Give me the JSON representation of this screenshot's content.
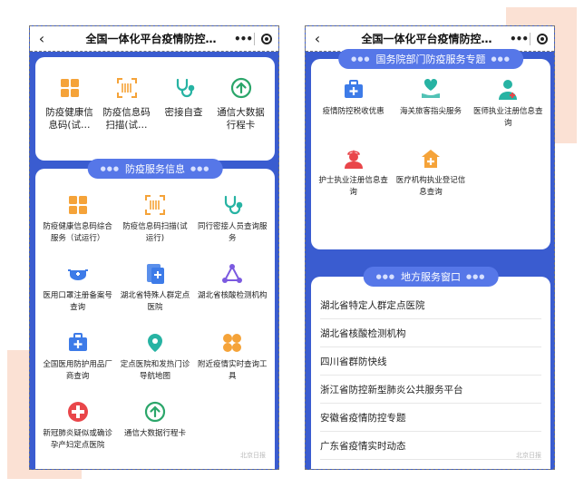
{
  "left_phone": {
    "title": "全国一体化平台疫情防控…",
    "quick_items": [
      {
        "icon": "grid-icon",
        "label": "防疫健康信息码(试…"
      },
      {
        "icon": "barcode-scan-icon",
        "label": "防疫信息码扫描(试…"
      },
      {
        "icon": "stethoscope-icon",
        "label": "密接自查"
      },
      {
        "icon": "arrow-up-circle-icon",
        "label": "通信大数据行程卡"
      }
    ],
    "section": {
      "title": "防疫服务信息",
      "items": [
        {
          "icon": "grid-icon",
          "label": "防疫健康信息码综合服务（试运行）"
        },
        {
          "icon": "barcode-scan-icon",
          "label": "防疫信息码扫描(试运行)"
        },
        {
          "icon": "stethoscope-icon",
          "label": "同行密接人员查询服务"
        },
        {
          "icon": "mask-icon",
          "label": "医用口罩注册备案号查询"
        },
        {
          "icon": "document-plus-icon",
          "label": "湖北省特殊人群定点医院"
        },
        {
          "icon": "network-icon",
          "label": "湖北省核酸检测机构"
        },
        {
          "icon": "medical-kit-icon",
          "label": "全国医用防护用品厂商查询"
        },
        {
          "icon": "location-pin-icon",
          "label": "定点医院和发热门诊导航地图"
        },
        {
          "icon": "clover-icon",
          "label": "附近疫情实时查询工具"
        },
        {
          "icon": "red-cross-icon",
          "label": "新冠肺炎疑似或确诊孕产妇定点医院"
        },
        {
          "icon": "arrow-up-circle-icon",
          "label": "通信大数据行程卡"
        }
      ],
      "watermark": "北京日报"
    }
  },
  "right_phone": {
    "title": "全国一体化平台疫情防控…",
    "section": {
      "title": "国务院部门防疫服务专题",
      "items": [
        {
          "icon": "medical-kit-icon",
          "label": "疫情防控税收优惠"
        },
        {
          "icon": "heart-hand-icon",
          "label": "海关旅客指尖服务"
        },
        {
          "icon": "doctor-icon",
          "label": "医师执业注册信息查询"
        },
        {
          "icon": "nurse-icon",
          "label": "护士执业注册信息查询"
        },
        {
          "icon": "hospital-icon",
          "label": "医疗机构执业登记信息查询"
        }
      ]
    },
    "local": {
      "title": "地方服务窗口",
      "items": [
        "湖北省特定人群定点医院",
        "湖北省核酸检测机构",
        "四川省群防快线",
        "浙江省防控新型肺炎公共服务平台",
        "安徽省疫情防控专题",
        "广东省疫情实时动态"
      ],
      "watermark": "北京日报"
    }
  },
  "colors": {
    "page_blue": "#3a5cd0",
    "pill_blue": "#5677e8",
    "orange": "#f5a339",
    "green": "#2ba66a",
    "teal": "#27b3a3",
    "blue": "#3d7be8",
    "purple": "#7b5ae0",
    "red": "#e9464a",
    "deco_peach": "#fbe1d4"
  }
}
